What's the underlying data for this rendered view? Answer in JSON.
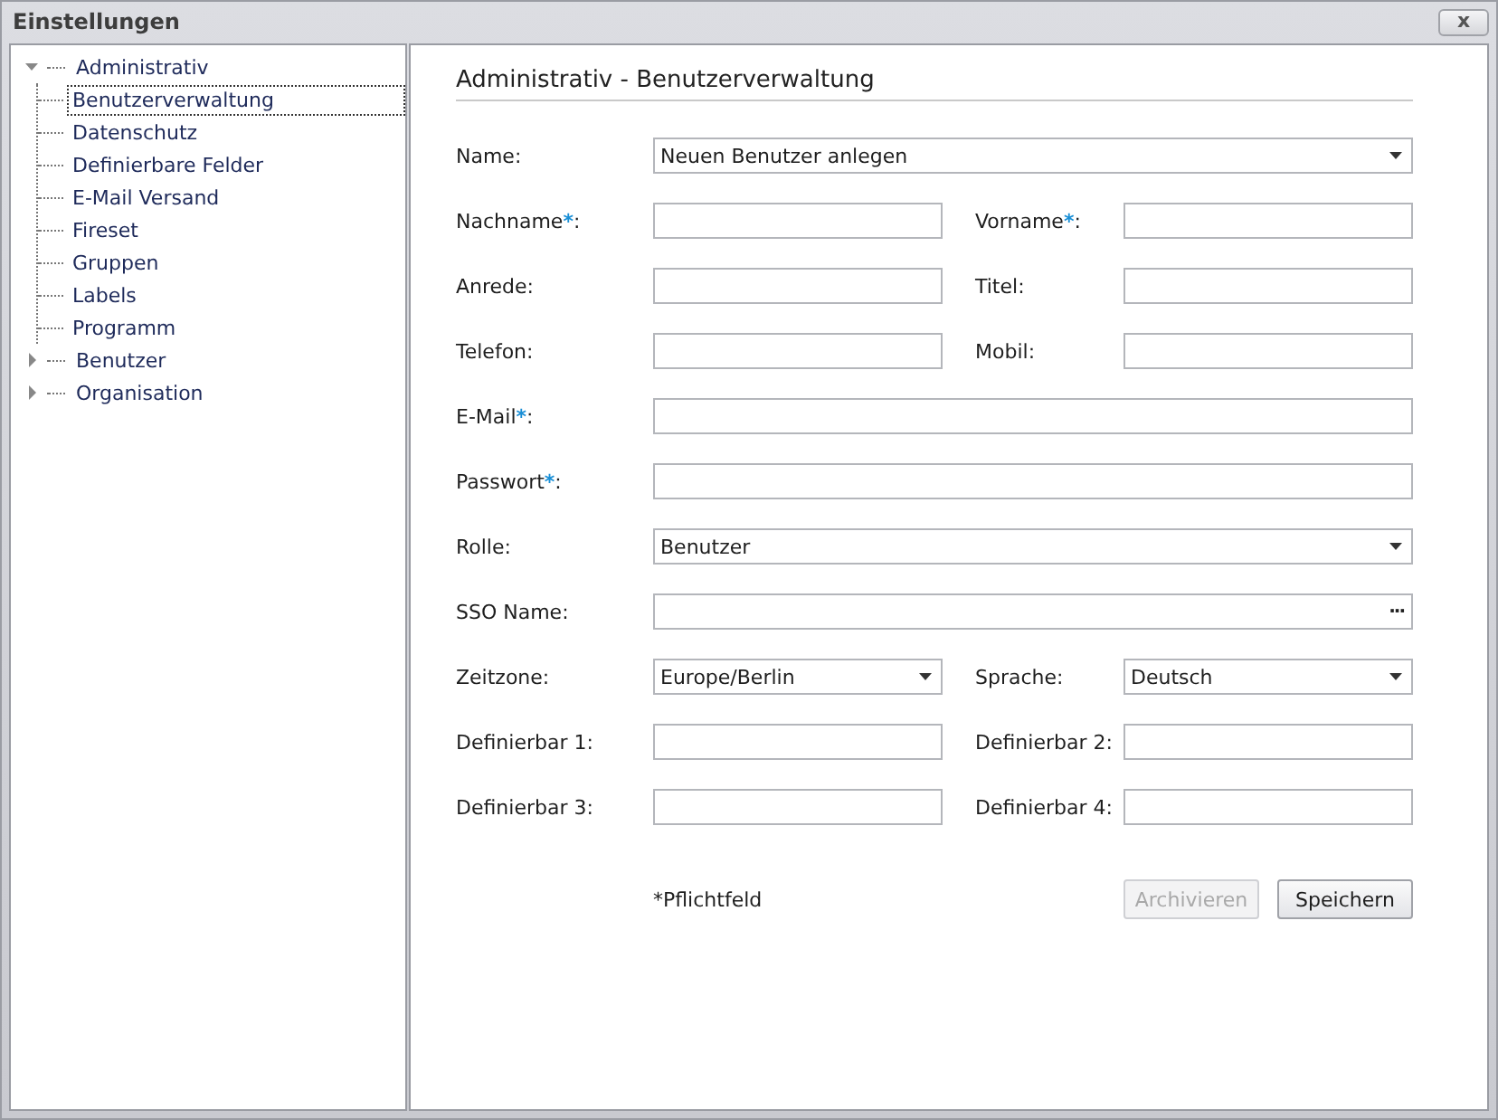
{
  "window": {
    "title": "Einstellungen",
    "close_label": "x"
  },
  "tree": [
    {
      "label": "Administrativ",
      "expanded": true,
      "selected": false,
      "children": [
        {
          "label": "Benutzerverwaltung",
          "selected": true
        },
        {
          "label": "Datenschutz",
          "selected": false
        },
        {
          "label": "Definierbare Felder",
          "selected": false
        },
        {
          "label": "E-Mail Versand",
          "selected": false
        },
        {
          "label": "Fireset",
          "selected": false
        },
        {
          "label": "Gruppen",
          "selected": false
        },
        {
          "label": "Labels",
          "selected": false
        },
        {
          "label": "Programm",
          "selected": false
        }
      ]
    },
    {
      "label": "Benutzer",
      "expanded": false,
      "selected": false
    },
    {
      "label": "Organisation",
      "expanded": false,
      "selected": false
    }
  ],
  "heading": "Administrativ - Benutzerverwaltung",
  "rows": [
    [
      {
        "label": "Name:",
        "kind": "combo",
        "value": "Neuen Benutzer anlegen",
        "wide": true
      }
    ],
    [
      {
        "label": "Nachname",
        "mark": "*",
        "label_end": ":",
        "kind": "text"
      },
      {
        "label": "Vorname",
        "mark": "*",
        "label_end": ":",
        "kind": "text"
      }
    ],
    [
      {
        "label": "Anrede:",
        "kind": "text"
      },
      {
        "label": "Titel:",
        "kind": "text"
      }
    ],
    [
      {
        "label": "Telefon:",
        "kind": "text"
      },
      {
        "label": "Mobil:",
        "kind": "text"
      }
    ],
    [
      {
        "label": "E-Mail",
        "mark": "*",
        "label_end": ":",
        "kind": "text",
        "wide": true
      }
    ],
    [
      {
        "label": "Passwort",
        "mark": "*",
        "label_end": ":",
        "kind": "text",
        "wide": true
      }
    ],
    [
      {
        "label": "Rolle:",
        "kind": "combo",
        "value": "Benutzer",
        "wide": true
      }
    ],
    [
      {
        "label": "SSO Name:",
        "kind": "ellipsis",
        "button": "···",
        "wide": true
      }
    ],
    [
      {
        "label": "Zeitzone:",
        "kind": "combo",
        "value": "Europe/Berlin"
      },
      {
        "label": "Sprache:",
        "kind": "combo",
        "value": "Deutsch"
      }
    ],
    [
      {
        "label": "Definierbar 1:",
        "kind": "text"
      },
      {
        "label": "Definierbar 2:",
        "kind": "text"
      }
    ],
    [
      {
        "label": "Definierbar 3:",
        "kind": "text"
      },
      {
        "label": "Definierbar 4:",
        "kind": "text"
      }
    ]
  ],
  "footnote": "*Pflichtfeld",
  "buttons": [
    {
      "label": "Archivieren",
      "disabled": true
    },
    {
      "label": "Speichern",
      "disabled": false
    }
  ]
}
